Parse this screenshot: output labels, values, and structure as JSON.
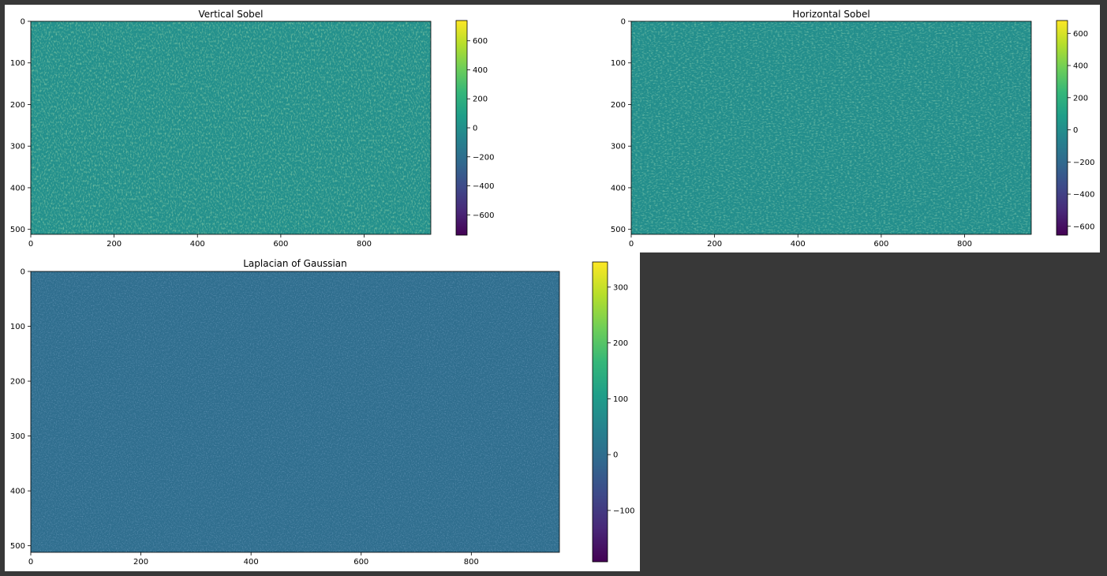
{
  "chart_data": [
    {
      "type": "heatmap",
      "title": "Vertical Sobel",
      "xlim": [
        0,
        960
      ],
      "ylim": [
        512,
        0
      ],
      "xticks": [
        0,
        200,
        400,
        600,
        800
      ],
      "yticks": [
        0,
        100,
        200,
        300,
        400,
        500
      ],
      "colorbar": {
        "colormap": "viridis",
        "range": [
          -740,
          740
        ],
        "ticks": [
          600,
          400,
          200,
          0,
          -200,
          -400,
          -600
        ]
      },
      "background_value": 0
    },
    {
      "type": "heatmap",
      "title": "Horizontal Sobel",
      "xlim": [
        0,
        960
      ],
      "ylim": [
        512,
        0
      ],
      "xticks": [
        0,
        200,
        400,
        600,
        800
      ],
      "yticks": [
        0,
        100,
        200,
        300,
        400,
        500
      ],
      "colorbar": {
        "colormap": "viridis",
        "range": [
          -655,
          680
        ],
        "ticks": [
          600,
          400,
          200,
          0,
          -200,
          -400,
          -600
        ]
      },
      "background_value": 0
    },
    {
      "type": "heatmap",
      "title": "Laplacian of Gaussian",
      "xlim": [
        0,
        960
      ],
      "ylim": [
        512,
        0
      ],
      "xticks": [
        0,
        200,
        400,
        600,
        800
      ],
      "yticks": [
        0,
        100,
        200,
        300,
        400,
        500
      ],
      "colorbar": {
        "colormap": "viridis",
        "range": [
          -192,
          345
        ],
        "ticks": [
          300,
          200,
          100,
          0,
          -100
        ]
      },
      "background_value": 0
    }
  ],
  "colors": {
    "figure_background": "#ffffff",
    "window_background": "#383838",
    "viridis_stops": [
      "#440154",
      "#482878",
      "#3e4989",
      "#31688e",
      "#26828e",
      "#1f9e89",
      "#35b779",
      "#6ece58",
      "#b5de2b",
      "#fde725"
    ]
  }
}
